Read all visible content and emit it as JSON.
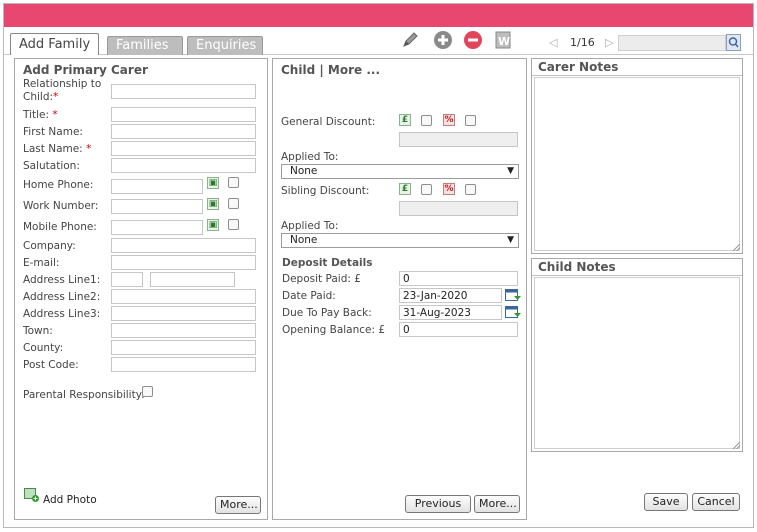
{
  "tabs": [
    {
      "label": "Add Family",
      "active": true
    },
    {
      "label": "Families",
      "active": false
    },
    {
      "label": "Enquiries",
      "active": false
    }
  ],
  "toolbar": {
    "edit_icon": "pencil-icon",
    "add_icon": "plus-circle-icon",
    "remove_icon": "minus-circle-icon",
    "word_icon": "word-document-icon",
    "pager_text": "1/16",
    "search_placeholder": ""
  },
  "colors": {
    "topbar": "#e8486f",
    "add": "#8a8a8a",
    "remove": "#e0455a"
  },
  "primary_carer": {
    "title": "Add Primary Carer",
    "fields": {
      "relationship_label_1": "Relationship to",
      "relationship_label_2": "Child:",
      "title_label": "Title:",
      "first_name_label": "First Name:",
      "last_name_label": "Last Name:",
      "salutation_label": "Salutation:",
      "home_phone_label": "Home Phone:",
      "work_number_label": "Work Number:",
      "mobile_phone_label": "Mobile Phone:",
      "company_label": "Company:",
      "email_label": "E-mail:",
      "address1_label": "Address Line1:",
      "address2_label": "Address Line2:",
      "address3_label": "Address Line3:",
      "town_label": "Town:",
      "county_label": "County:",
      "postcode_label": "Post Code:",
      "parental_label": "Parental Responsibility:"
    },
    "required_mark": "*",
    "add_photo_label": "Add Photo",
    "more_button": "More..."
  },
  "child": {
    "title": "Child | More ...",
    "general_discount_label": "General Discount:",
    "pound_symbol": "£",
    "percent_symbol": "%",
    "applied_to_label": "Applied To:",
    "applied_to_value": "None",
    "sibling_discount_label": "Sibling Discount:",
    "applied_to_label_2": "Applied To:",
    "applied_to_value_2": "None",
    "deposit_header": "Deposit Details",
    "deposit_paid_label": "Deposit Paid: £",
    "deposit_paid_value": "0",
    "date_paid_label": "Date Paid:",
    "date_paid_value": "23-Jan-2020",
    "due_back_label": "Due To Pay Back:",
    "due_back_value": "31-Aug-2023",
    "opening_balance_label": "Opening Balance: £",
    "opening_balance_value": "0",
    "previous_button": "Previous",
    "more_button": "More..."
  },
  "notes": {
    "carer_title": "Carer Notes",
    "child_title": "Child Notes",
    "save_button": "Save",
    "cancel_button": "Cancel"
  }
}
